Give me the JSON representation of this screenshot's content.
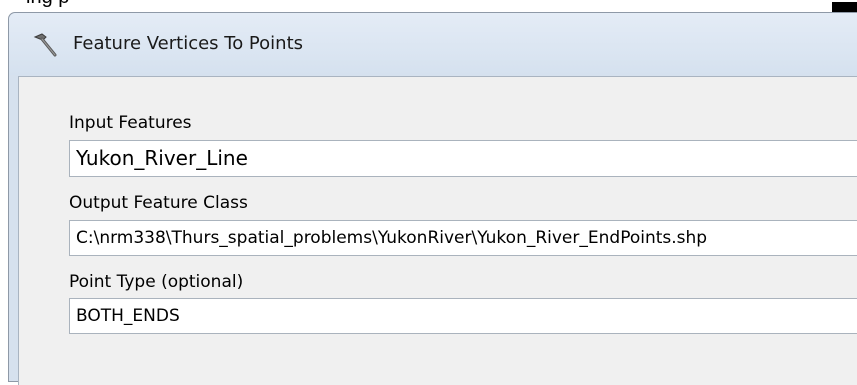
{
  "backdrop": {
    "text": "ing p"
  },
  "window": {
    "title": "Feature Vertices To Points",
    "icon": "hammer-icon"
  },
  "form": {
    "input_features": {
      "label": "Input Features",
      "value": "Yukon_River_Line"
    },
    "output_feature_class": {
      "label": "Output Feature Class",
      "value": "C:\\nrm338\\Thurs_spatial_problems\\YukonRiver\\Yukon_River_EndPoints.shp"
    },
    "point_type": {
      "label": "Point Type (optional)",
      "value": "BOTH_ENDS"
    }
  }
}
